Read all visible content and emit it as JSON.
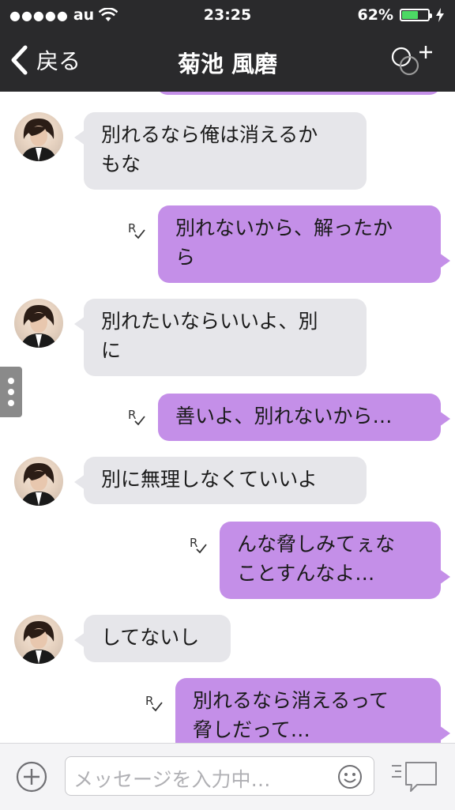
{
  "status_bar": {
    "signal_dots": "●●●●●",
    "carrier": "au",
    "time": "23:25",
    "battery_percent": "62%",
    "battery_level": 0.62
  },
  "navbar": {
    "back_label": "戻る",
    "title": "菊池 風磨"
  },
  "messages": [
    {
      "side": "in",
      "text": "別れるなら俺は消えるか\nもな"
    },
    {
      "side": "out",
      "text": "別れないから、解ったか\nら",
      "read_mark": "R"
    },
    {
      "side": "in",
      "text": "別れたいならいいよ、別\nに"
    },
    {
      "side": "out",
      "text": "善いよ、別れないから…",
      "read_mark": "R"
    },
    {
      "side": "in",
      "text": "別に無理しなくていいよ"
    },
    {
      "side": "out",
      "text": "んな脅しみてぇな\nことすんなよ…",
      "read_mark": "R"
    },
    {
      "side": "in",
      "text": "してないし"
    },
    {
      "side": "out",
      "text": "別れるなら消えるって\n脅しだって…",
      "read_mark": "R"
    }
  ],
  "input": {
    "placeholder": "メッセージを入力中…"
  },
  "colors": {
    "header_bg": "#2a2a2c",
    "incoming_bubble": "#e6e6ea",
    "outgoing_bubble": "#c48fe8",
    "battery_fill": "#4cd964"
  }
}
